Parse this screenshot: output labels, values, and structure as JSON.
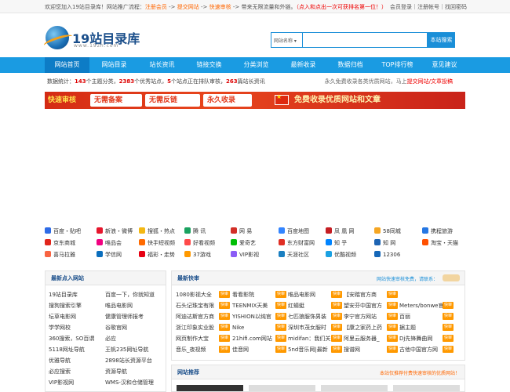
{
  "topbar": {
    "welcome": "欢迎您加入19站目录库！网站推广流程：",
    "step1": "注册会员",
    "arrow1": " -> ",
    "step2": "提交网站",
    "arrow2": " -> ",
    "step3": "快速审核",
    "tail": " -> 带来无限流量和外链。",
    "promo": "（点入和点出一次可获排名第一位！）",
    "login": "会员登录",
    "sep1": "｜",
    "register": "注册帐号",
    "sep2": "｜",
    "forgot": "找回密码"
  },
  "logo": {
    "name": "19站目录库",
    "domain": "www.19zh.com"
  },
  "search": {
    "select_label": "网站名称 ▾",
    "placeholder": "",
    "button": "本站搜索"
  },
  "nav": [
    "网站首页",
    "网站目录",
    "站长资讯",
    "链接交换",
    "分类浏览",
    "最新收录",
    "数据归档",
    "TOP排行榜",
    "意见建议"
  ],
  "stats": {
    "prefix": "数据统计：",
    "sites": "143",
    "t1": "个主题分类，",
    "quality": "2383",
    "t2": "个优秀站点，",
    "pending": "5",
    "t3": "个站点正在排队审核，",
    "news": "263",
    "t4": "篇站长资讯"
  },
  "notice": {
    "text": "永久免费收录各类优质网站，马上",
    "link": "提交网站/文章投稿"
  },
  "banner": {
    "b1": "快速审核",
    "b2": "无需备案",
    "b3": "无需反链",
    "b4": "永久收录",
    "slogan": "免费收录优质网站和文章"
  },
  "famous_sites": [
    {
      "label": "百度・贴吧",
      "color": "#2e6be6"
    },
    {
      "label": "新浪・微博",
      "color": "#e6162d"
    },
    {
      "label": "搜狐・热点",
      "color": "#f3b814"
    },
    {
      "label": "腾 讯",
      "color": "#1aa260"
    },
    {
      "label": "网 易",
      "color": "#d22f27"
    },
    {
      "label": "百度地图",
      "color": "#3385ff"
    },
    {
      "label": "凤 凰 网",
      "color": "#c51e23"
    },
    {
      "label": "58同城",
      "color": "#f5a623"
    },
    {
      "label": "携程旅游",
      "color": "#2577e3"
    },
    {
      "label": "京东商城",
      "color": "#e1251b"
    },
    {
      "label": "唯品会",
      "color": "#f10180"
    },
    {
      "label": "快手短视频",
      "color": "#ff6a00"
    },
    {
      "label": "好看视频",
      "color": "#ff4a4a"
    },
    {
      "label": "爱奇艺",
      "color": "#00be06"
    },
    {
      "label": "东方财富网",
      "color": "#e02e24"
    },
    {
      "label": "知 乎",
      "color": "#0084ff"
    },
    {
      "label": "知 网",
      "color": "#1d64b3"
    },
    {
      "label": "淘宝・天猫",
      "color": "#ff5000"
    },
    {
      "label": "喜马拉雅",
      "color": "#f86442"
    },
    {
      "label": "学信网",
      "color": "#0a6ebd"
    },
    {
      "label": "福彩・走势",
      "color": "#e60012"
    },
    {
      "label": "37游戏",
      "color": "#ff9900"
    },
    {
      "label": "VIP影视",
      "color": "#8b5cf6"
    },
    {
      "label": "天涯社区",
      "color": "#1a7fc1"
    },
    {
      "label": "优酷视频",
      "color": "#1ba1e2"
    },
    {
      "label": "12306",
      "color": "#1667b8"
    }
  ],
  "latest_sites": {
    "title": "最新点入网站",
    "items": [
      "19站目录库",
      "百度一下，你就知道",
      "搜狗搜索引擎",
      "唯品电影网",
      "坛草电影网",
      "健康管理师报考",
      "学学网校",
      "谷歌官网",
      "360搜索，SO百谓",
      "必应",
      "5118网址导航",
      "王帆235网址导航",
      "优雅导航",
      "2898站长资源平台",
      "必应搜索",
      "资源导航",
      "VIP影视网",
      "WMS-汉和仓储管理"
    ]
  },
  "new_listing": {
    "title": "最新快审",
    "right": "网站快速审核免费，请联系：",
    "rows": [
      [
        "1080影视大全",
        "看看影院",
        "唯品电影网",
        "【安踏官方商"
      ],
      [
        "石头记珠宝有限",
        "TEENMIX天美",
        "红蜻蜓",
        "望安芬中国官方",
        "Meters/bonwe官"
      ],
      [
        "阿迪达斯官方商",
        "YISHION以纯官",
        "七匹狼服饰男装",
        "李宁官方网站",
        "百丽"
      ],
      [
        "浙江印象实业股",
        "Nike",
        "深圳市茂女服时",
        "【康之家药上药",
        "据主题"
      ],
      [
        "网页制作大宝",
        "21hifi.com网站",
        "midifan：我们关",
        "阿里云服务器_",
        "Dj先锋舞曲网"
      ],
      [
        "音乐_夜视频",
        "佳音网",
        "5nd音乐网|最新",
        "搜谱网",
        "古他中国官方网"
      ]
    ],
    "tag": "快审"
  },
  "recommend": {
    "title": "网站推荐",
    "right": "本站仅推荐付费快速审核的优质网站！"
  }
}
